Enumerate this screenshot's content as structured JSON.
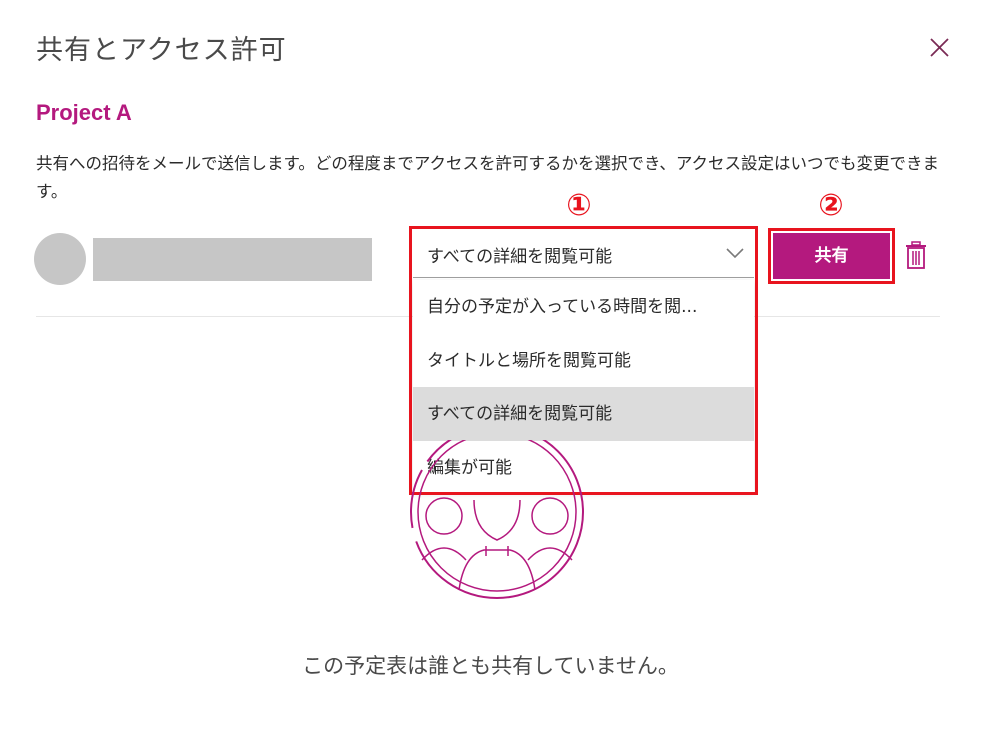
{
  "dialog": {
    "title": "共有とアクセス許可",
    "close_icon": "close-icon"
  },
  "project": {
    "name": "Project A"
  },
  "description": "共有への招待をメールで送信します。どの程度までアクセスを許可するかを選択でき、アクセス設定はいつでも変更できます。",
  "share_entry": {
    "permission_selected": "すべての詳細を閲覧可能",
    "share_button_label": "共有",
    "delete_icon": "trash-icon"
  },
  "permission_menu": {
    "items": [
      {
        "label": "自分の予定が入っている時間を閲..."
      },
      {
        "label": "タイトルと場所を閲覧可能"
      },
      {
        "label": "すべての詳細を閲覧可能"
      },
      {
        "label": "編集が可能"
      }
    ]
  },
  "annotations": {
    "marker_1": "①",
    "marker_2": "②"
  },
  "empty_state": {
    "message": "この予定表は誰とも共有していません。"
  },
  "colors": {
    "accent": "#b4197e",
    "annotation_red": "#e8141e",
    "selected_row": "#dcdcdc",
    "placeholder_gray": "#c6c6c6"
  }
}
